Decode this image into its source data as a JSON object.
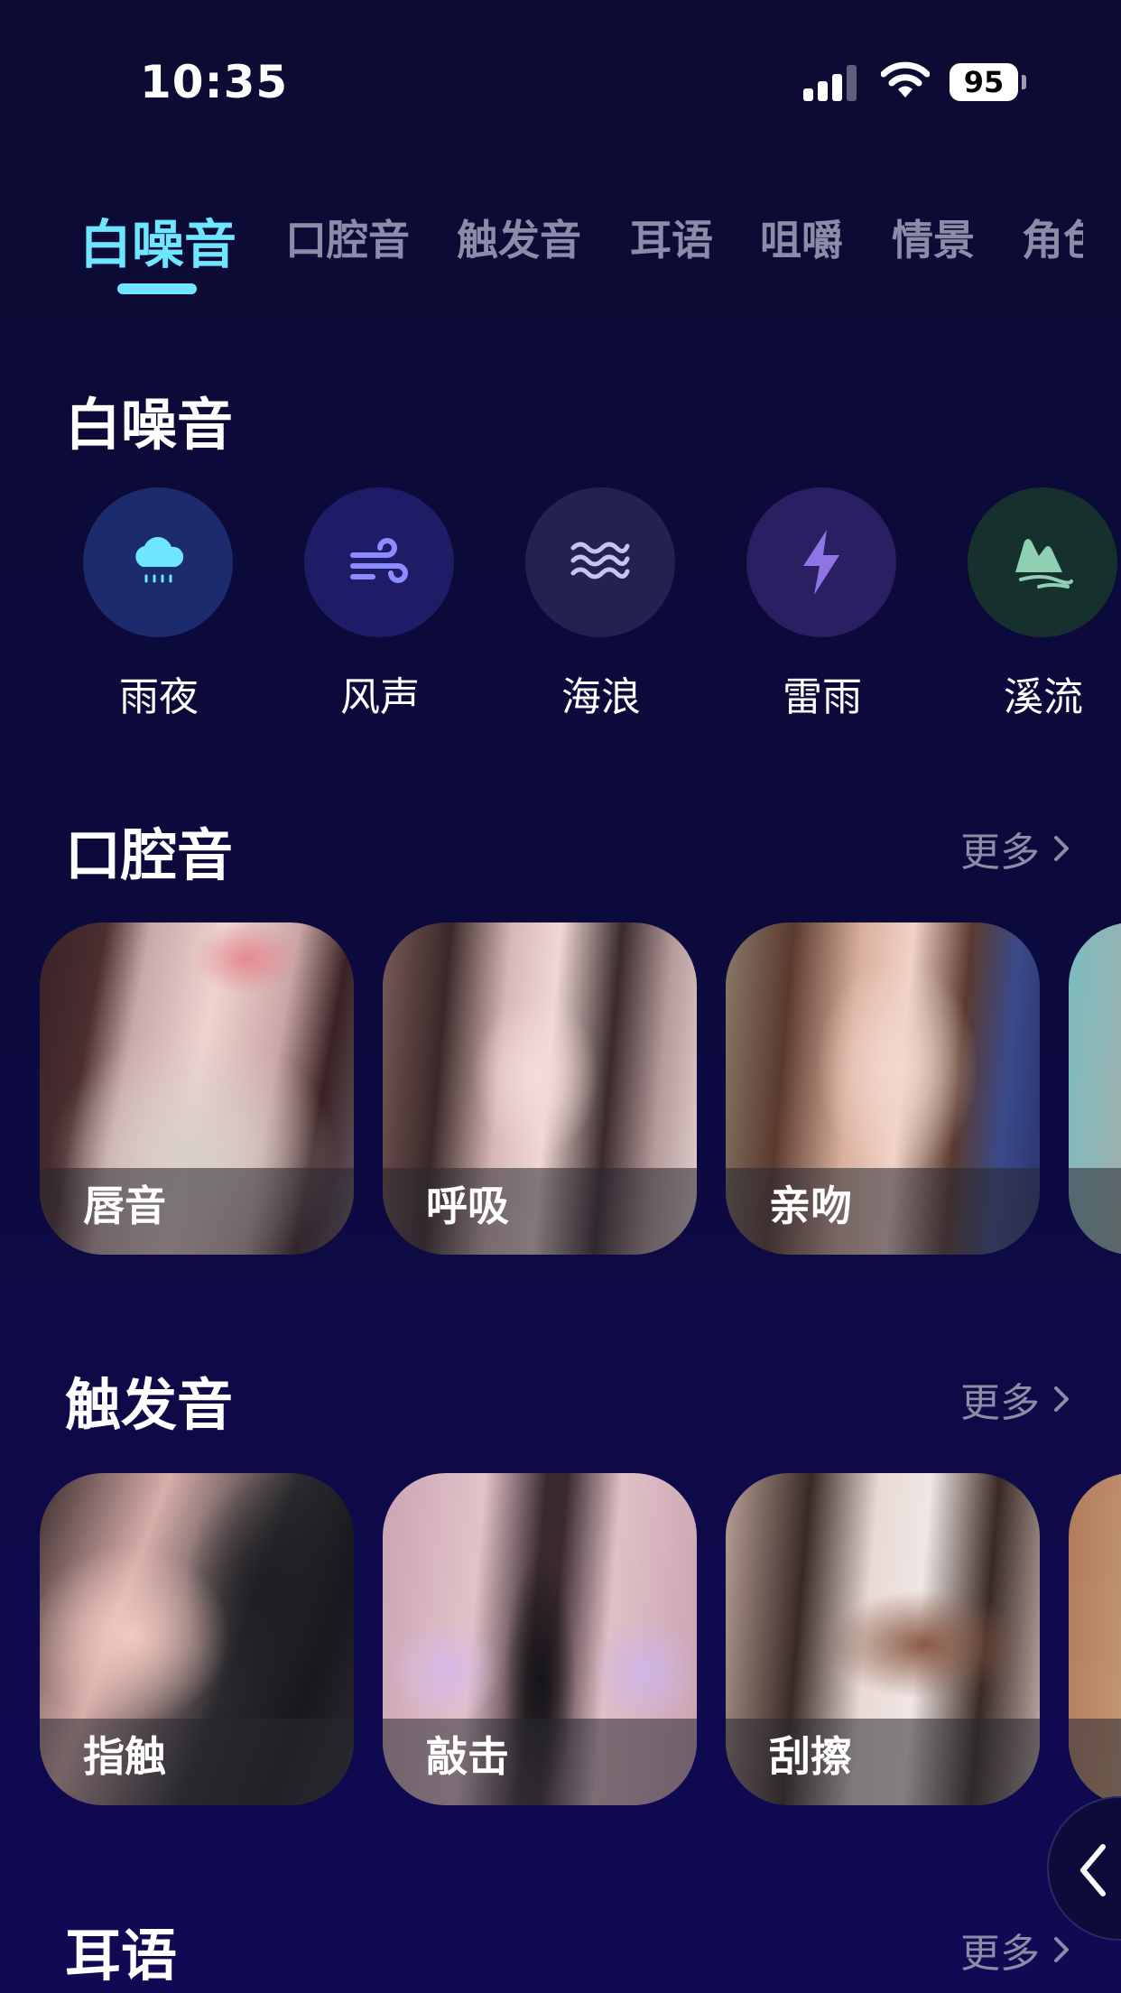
{
  "status": {
    "time": "10:35",
    "battery": "95"
  },
  "tabs": [
    "白噪音",
    "口腔音",
    "触发音",
    "耳语",
    "咀嚼",
    "情景",
    "角色"
  ],
  "white_noise": {
    "title": "白噪音",
    "items": [
      {
        "label": "雨夜",
        "icon": "rain-cloud-icon",
        "color": "#1c2a6e"
      },
      {
        "label": "风声",
        "icon": "wind-icon",
        "color": "#1e1c66"
      },
      {
        "label": "海浪",
        "icon": "waves-icon",
        "color": "#24204f"
      },
      {
        "label": "雷雨",
        "icon": "lightning-icon",
        "color": "#2a1f62"
      },
      {
        "label": "溪流",
        "icon": "stream-icon",
        "color": "#16302e"
      }
    ]
  },
  "oral": {
    "title": "口腔音",
    "more": "更多",
    "cards": [
      {
        "label": "唇音"
      },
      {
        "label": "呼吸"
      },
      {
        "label": "亲吻"
      }
    ]
  },
  "trigger": {
    "title": "触发音",
    "more": "更多",
    "cards": [
      {
        "label": "指触"
      },
      {
        "label": "敲击"
      },
      {
        "label": "刮擦"
      }
    ]
  },
  "whisper": {
    "title": "耳语",
    "more": "更多"
  },
  "colors": {
    "accent": "#6ee6ff",
    "background": "#0b0b33"
  }
}
